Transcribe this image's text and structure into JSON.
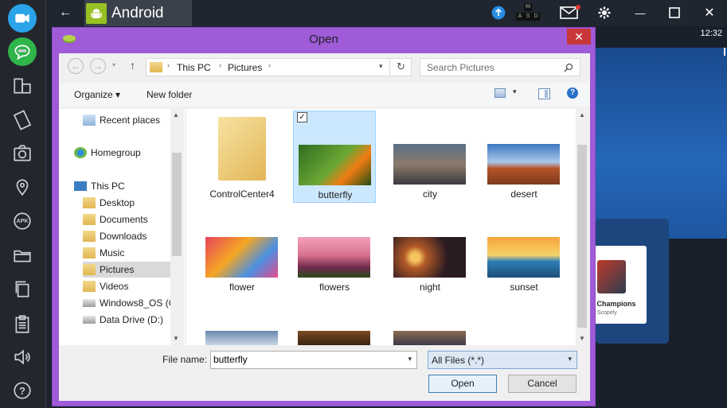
{
  "sidebar": {
    "icons": [
      "video-icon",
      "chat-icon",
      "multiwindow-icon",
      "rotate-icon",
      "camera-icon",
      "location-icon",
      "apk-icon",
      "folder-icon",
      "copy-icon",
      "clipboard-icon",
      "volume-icon",
      "help-icon"
    ],
    "apk_label": "APK",
    "help_label": "?"
  },
  "topbar": {
    "back_glyph": "←",
    "title": "Android",
    "keys": [
      "W",
      "A",
      "S",
      "D"
    ],
    "minimize_glyph": "—",
    "close_glyph": "✕"
  },
  "status": {
    "time": "12:32"
  },
  "app_card": {
    "name": "t Champions",
    "publisher": "Scopely"
  },
  "dialog": {
    "title": "Open",
    "close_glyph": "✕",
    "breadcrumb": [
      "This PC",
      "Pictures"
    ],
    "search_placeholder": "Search Pictures",
    "organize_label": "Organize ▾",
    "new_folder_label": "New folder",
    "nav_items": [
      {
        "label": "Recent places",
        "icon": "recent-places-icon"
      },
      {
        "label": "Homegroup",
        "icon": "homegroup-icon"
      },
      {
        "label": "This PC",
        "icon": "computer-icon"
      },
      {
        "label": "Desktop",
        "icon": "folder-icon"
      },
      {
        "label": "Documents",
        "icon": "folder-icon"
      },
      {
        "label": "Downloads",
        "icon": "folder-icon"
      },
      {
        "label": "Music",
        "icon": "folder-icon"
      },
      {
        "label": "Pictures",
        "icon": "folder-icon"
      },
      {
        "label": "Videos",
        "icon": "folder-icon"
      },
      {
        "label": "Windows8_OS (C",
        "icon": "drive-icon"
      },
      {
        "label": "Data Drive (D:)",
        "icon": "drive-icon"
      }
    ],
    "files": [
      {
        "name": "ControlCenter4",
        "kind": "folder"
      },
      {
        "name": "butterfly",
        "kind": "image",
        "selected": true
      },
      {
        "name": "city",
        "kind": "image"
      },
      {
        "name": "desert",
        "kind": "image"
      },
      {
        "name": "flower",
        "kind": "image"
      },
      {
        "name": "flowers",
        "kind": "image"
      },
      {
        "name": "night",
        "kind": "image"
      },
      {
        "name": "sunset",
        "kind": "image"
      }
    ],
    "file_name_label": "File name:",
    "file_name_value": "butterfly",
    "filter_value": "All Files (*.*)",
    "open_label": "Open",
    "cancel_label": "Cancel"
  },
  "colors": {
    "dialog_frame": "#a05bd8",
    "selection": "#cce8ff",
    "close_red": "#c8383a"
  }
}
